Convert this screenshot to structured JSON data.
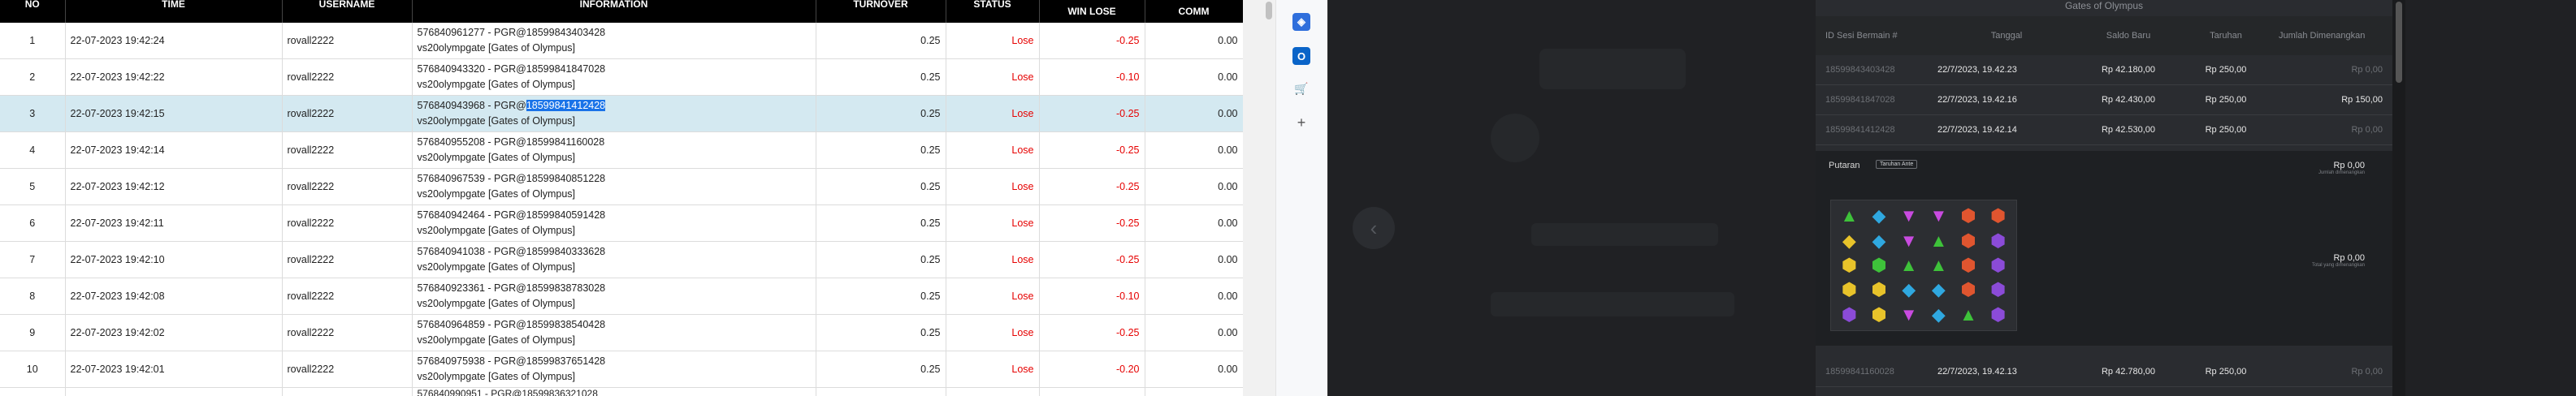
{
  "table": {
    "headers": [
      "NO",
      "TIME",
      "USERNAME",
      "INFORMATION",
      "TURNOVER",
      "STATUS",
      "WIN LOSE",
      "COMM"
    ],
    "rows": [
      {
        "no": "1",
        "time": "22-07-2023 19:42:24",
        "user": "rovall2222",
        "info1": "576840961277 - PGR@18599843403428",
        "info2": "vs20olympgate [Gates of Olympus]",
        "turnover": "0.25",
        "status": "Lose",
        "winlose": "-0.25",
        "comm": "0.00"
      },
      {
        "no": "2",
        "time": "22-07-2023 19:42:22",
        "user": "rovall2222",
        "info1": "576840943320 - PGR@18599841847028",
        "info2": "vs20olympgate [Gates of Olympus]",
        "turnover": "0.25",
        "status": "Lose",
        "winlose": "-0.10",
        "comm": "0.00"
      },
      {
        "no": "3",
        "time": "22-07-2023 19:42:15",
        "user": "rovall2222",
        "info1": "576840943968 - PGR@",
        "info1hl": "18599841412428",
        "info2": "vs20olympgate [Gates of Olympus]",
        "turnover": "0.25",
        "status": "Lose",
        "winlose": "-0.25",
        "comm": "0.00"
      },
      {
        "no": "4",
        "time": "22-07-2023 19:42:14",
        "user": "rovall2222",
        "info1": "576840955208 - PGR@18599841160028",
        "info2": "vs20olympgate [Gates of Olympus]",
        "turnover": "0.25",
        "status": "Lose",
        "winlose": "-0.25",
        "comm": "0.00"
      },
      {
        "no": "5",
        "time": "22-07-2023 19:42:12",
        "user": "rovall2222",
        "info1": "576840967539 - PGR@18599840851228",
        "info2": "vs20olympgate [Gates of Olympus]",
        "turnover": "0.25",
        "status": "Lose",
        "winlose": "-0.25",
        "comm": "0.00"
      },
      {
        "no": "6",
        "time": "22-07-2023 19:42:11",
        "user": "rovall2222",
        "info1": "576840942464 - PGR@18599840591428",
        "info2": "vs20olympgate [Gates of Olympus]",
        "turnover": "0.25",
        "status": "Lose",
        "winlose": "-0.25",
        "comm": "0.00"
      },
      {
        "no": "7",
        "time": "22-07-2023 19:42:10",
        "user": "rovall2222",
        "info1": "576840941038 - PGR@18599840333628",
        "info2": "vs20olympgate [Gates of Olympus]",
        "turnover": "0.25",
        "status": "Lose",
        "winlose": "-0.25",
        "comm": "0.00"
      },
      {
        "no": "8",
        "time": "22-07-2023 19:42:08",
        "user": "rovall2222",
        "info1": "576840923361 - PGR@18599838783028",
        "info2": "vs20olympgate [Gates of Olympus]",
        "turnover": "0.25",
        "status": "Lose",
        "winlose": "-0.10",
        "comm": "0.00"
      },
      {
        "no": "9",
        "time": "22-07-2023 19:42:02",
        "user": "rovall2222",
        "info1": "576840964859 - PGR@18599838540428",
        "info2": "vs20olympgate [Gates of Olympus]",
        "turnover": "0.25",
        "status": "Lose",
        "winlose": "-0.25",
        "comm": "0.00"
      },
      {
        "no": "10",
        "time": "22-07-2023 19:42:01",
        "user": "rovall2222",
        "info1": "576840975938 - PGR@18599837651428",
        "info2": "vs20olympgate [Gates of Olympus]",
        "turnover": "0.25",
        "status": "Lose",
        "winlose": "-0.20",
        "comm": "0.00"
      }
    ],
    "partial_row": "576840990951 - PGR@18599836321028"
  },
  "sidebar": {
    "icons": [
      {
        "name": "copilot-icon",
        "glyph": "◈",
        "color": "#2f6fdc"
      },
      {
        "name": "outlook-icon",
        "glyph": "O",
        "color": "#0a64c8"
      },
      {
        "name": "shopping-icon",
        "glyph": "🛒",
        "color": "#1a73e8"
      }
    ],
    "add_label": "+"
  },
  "game": {
    "panel_title": "Gates of Olympus",
    "headers": [
      "ID Sesi Bermain #",
      "Tanggal",
      "Saldo Baru",
      "Taruhan",
      "Jumlah Dimenangkan"
    ],
    "rows": [
      {
        "id": "18599843403428",
        "date": "22/7/2023, 19.42.23",
        "saldo": "Rp 42.180,00",
        "bet": "Rp 250,00",
        "win": "Rp 0,00"
      },
      {
        "id": "18599841847028",
        "date": "22/7/2023, 19.42.16",
        "saldo": "Rp 42.430,00",
        "bet": "Rp 250,00",
        "win": "Rp 150,00"
      },
      {
        "id": "18599841412428",
        "date": "22/7/2023, 19.42.14",
        "saldo": "Rp 42.530,00",
        "bet": "Rp 250,00",
        "win": "Rp 0,00"
      }
    ],
    "detail": {
      "putaran_label": "Putaran",
      "tag_label": "Taruhan Ante",
      "amount1": "Rp 0,00",
      "amount1_sub": "Jumlah dimenangkan",
      "amount2": "Rp 0,00",
      "amount2_sub": "Total yang dimenangkan"
    },
    "last_row": {
      "id": "18599841160028",
      "date": "22/7/2023, 19.42.13",
      "saldo": "Rp 42.780,00",
      "bet": "Rp 250,00",
      "win": "Rp 0,00"
    },
    "reel_symbols": [
      [
        "▲",
        "◆",
        "▼",
        "▼",
        "⬢",
        "⬢"
      ],
      [
        "◆",
        "◆",
        "▼",
        "▲",
        "⬢",
        "⬢"
      ],
      [
        "⬢",
        "⬢",
        "▲",
        "▲",
        "⬢",
        "⬢"
      ],
      [
        "⬢",
        "⬢",
        "◆",
        "◆",
        "⬢",
        "⬢"
      ],
      [
        "⬢",
        "⬢",
        "▼",
        "◆",
        "▲",
        "⬢"
      ]
    ],
    "reel_colors": [
      [
        "#3ec23a",
        "#2fa8e0",
        "#c94be0",
        "#c94be0",
        "#e0552f",
        "#e0552f"
      ],
      [
        "#e8c32a",
        "#2fa8e0",
        "#c94be0",
        "#3ec23a",
        "#e0552f",
        "#8b4bd8"
      ],
      [
        "#e8c32a",
        "#3ec23a",
        "#3ec23a",
        "#3ec23a",
        "#e0552f",
        "#8b4bd8"
      ],
      [
        "#e8c32a",
        "#e8c32a",
        "#2fa8e0",
        "#2fa8e0",
        "#e0552f",
        "#8b4bd8"
      ],
      [
        "#8b4bd8",
        "#e8c32a",
        "#c94be0",
        "#2fa8e0",
        "#3ec23a",
        "#8b4bd8"
      ]
    ]
  }
}
